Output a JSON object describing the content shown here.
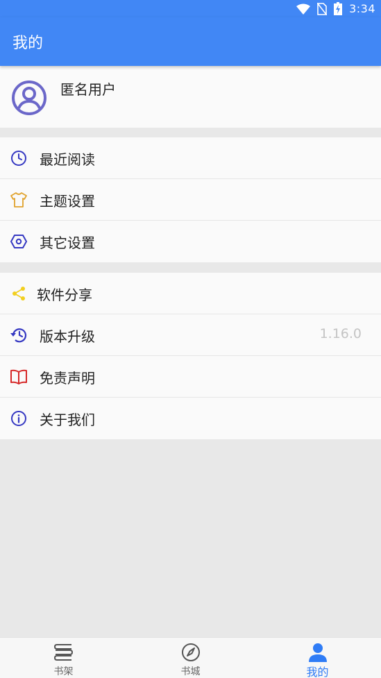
{
  "status_bar": {
    "time": "3:34",
    "icons": [
      "wifi-icon",
      "no-sim-icon",
      "battery-charging-icon"
    ]
  },
  "app_bar": {
    "title": "我的"
  },
  "profile": {
    "name": "匿名用户",
    "avatar_icon": "user-circle-icon"
  },
  "menu_group_1": [
    {
      "label": "最近阅读",
      "icon": "clock-icon",
      "color": "#3538c2"
    },
    {
      "label": "主题设置",
      "icon": "tshirt-icon",
      "color": "#e0a22c"
    },
    {
      "label": "其它设置",
      "icon": "hexagon-settings-icon",
      "color": "#3538c2"
    }
  ],
  "menu_group_2": [
    {
      "label": "软件分享",
      "icon": "share-icon",
      "color": "#f2cf1f"
    },
    {
      "label": "版本升级",
      "icon": "history-icon",
      "color": "#3538c2",
      "value": "1.16.0"
    },
    {
      "label": "免责声明",
      "icon": "book-open-icon",
      "color": "#d62828"
    },
    {
      "label": "关于我们",
      "icon": "info-icon",
      "color": "#3538c2"
    }
  ],
  "bottom_nav": [
    {
      "label": "书架",
      "icon": "bookshelf-icon",
      "active": false
    },
    {
      "label": "书城",
      "icon": "compass-icon",
      "active": false
    },
    {
      "label": "我的",
      "icon": "person-icon",
      "active": true
    }
  ],
  "colors": {
    "primary": "#4187f5",
    "active_tab": "#2f7cf6",
    "avatar": "#6b67c9",
    "divider_bg": "#e8e8e8"
  }
}
